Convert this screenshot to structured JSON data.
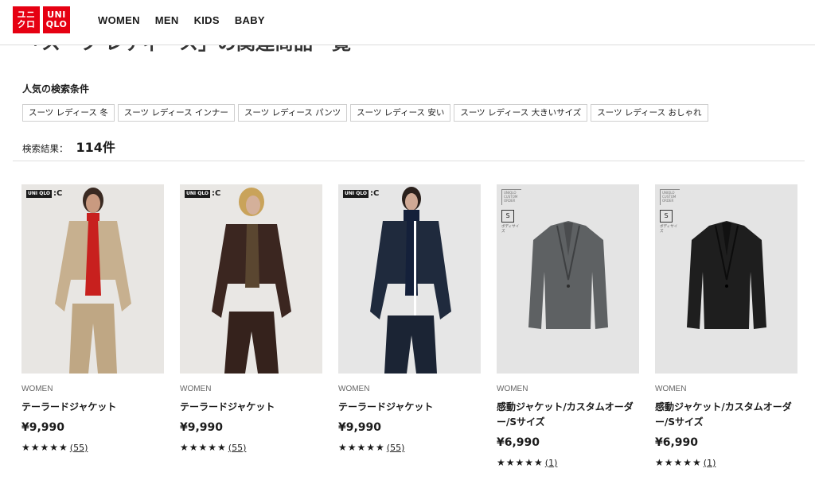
{
  "header": {
    "logo": {
      "tile1_line1": "ユニ",
      "tile1_line2": "クロ",
      "tile2_line1": "UNI",
      "tile2_line2": "QLO"
    },
    "nav": [
      "WOMEN",
      "MEN",
      "KIDS",
      "BABY"
    ]
  },
  "page_title": "「スーツ レディース」の関連商品一覧",
  "popular": {
    "heading": "人気の検索条件",
    "chips": [
      "スーツ レディース 冬",
      "スーツ レディース インナー",
      "スーツ レディース パンツ",
      "スーツ レディース 安い",
      "スーツ レディース 大きいサイズ",
      "スーツ レディース おしゃれ"
    ]
  },
  "results": {
    "label": "検索結果：",
    "count": "114件"
  },
  "products": [
    {
      "category": "WOMEN",
      "name": "テーラードジャケット",
      "price": "¥9,990",
      "stars": "★★★★★",
      "reviews": "(55)",
      "brand_badge": ":C",
      "brand_box": "UNI QLO",
      "bg": "#e8e6e3",
      "jacket": "#c7b08f",
      "inner": "#c8201e"
    },
    {
      "category": "WOMEN",
      "name": "テーラードジャケット",
      "price": "¥9,990",
      "stars": "★★★★★",
      "reviews": "(55)",
      "brand_badge": ":C",
      "brand_box": "UNI QLO",
      "bg": "#e9e7e4",
      "jacket": "#3b2620",
      "inner": "#5a4630"
    },
    {
      "category": "WOMEN",
      "name": "テーラードジャケット",
      "price": "¥9,990",
      "stars": "★★★★★",
      "reviews": "(55)",
      "brand_badge": ":C",
      "brand_box": "UNI QLO",
      "bg": "#e6e6e6",
      "jacket": "#1f2a3d",
      "inner": "#14203a"
    },
    {
      "category": "WOMEN",
      "name": "感動ジャケット/カスタムオーダー/Sサイズ",
      "price": "¥6,990",
      "stars": "★★★★★",
      "reviews": "(1)",
      "badge_text": "UNIQLO CUSTOM ORDER",
      "size": "S",
      "body_label": "ボディサイズ",
      "bg": "#e4e4e4",
      "jacket": "#5e6163"
    },
    {
      "category": "WOMEN",
      "name": "感動ジャケット/カスタムオーダー/Sサイズ",
      "price": "¥6,990",
      "stars": "★★★★★",
      "reviews": "(1)",
      "badge_text": "UNIQLO CUSTOM ORDER",
      "size": "S",
      "body_label": "ボディサイズ",
      "bg": "#e4e4e4",
      "jacket": "#1e1e1e"
    }
  ]
}
